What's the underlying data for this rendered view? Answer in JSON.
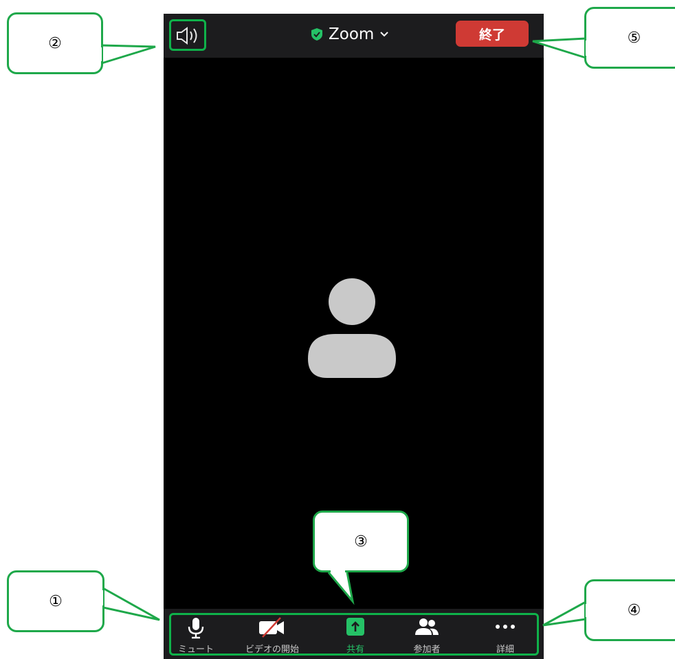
{
  "header": {
    "title": "Zoom",
    "end_button": "終了"
  },
  "toolbar": {
    "items": [
      {
        "label": "ミュート",
        "icon": "microphone-icon"
      },
      {
        "label": "ビデオの開始",
        "icon": "video-off-icon"
      },
      {
        "label": "共有",
        "icon": "share-icon"
      },
      {
        "label": "参加者",
        "icon": "participants-icon"
      },
      {
        "label": "詳細",
        "icon": "more-icon"
      }
    ]
  },
  "callouts": {
    "c1": "①",
    "c2": "②",
    "c3": "③",
    "c4": "④",
    "c5": "⑤"
  },
  "colors": {
    "accent_green": "#0fb24a",
    "share_green": "#25c166",
    "end_red": "#cf3a34",
    "bar_bg": "#1c1c1e"
  }
}
